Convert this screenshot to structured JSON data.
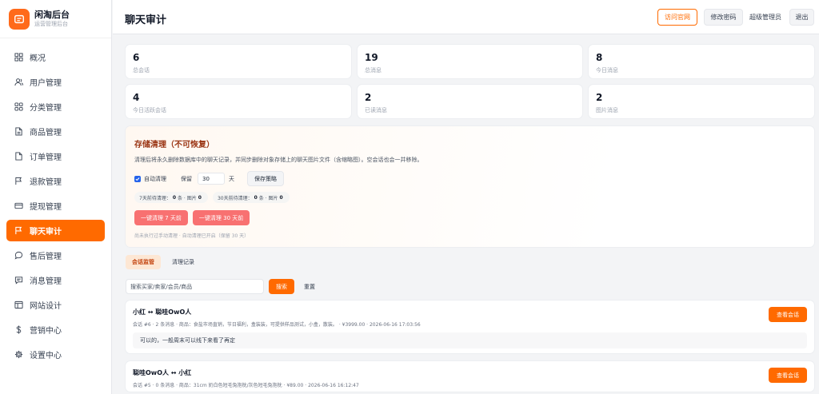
{
  "brand": {
    "title": "闲淘后台",
    "subtitle": "运营管理后台",
    "accent": "#ff6a00"
  },
  "sidebar": {
    "items": [
      {
        "label": "概况",
        "icon": "grid-icon"
      },
      {
        "label": "用户管理",
        "icon": "users-icon"
      },
      {
        "label": "分类管理",
        "icon": "category-icon"
      },
      {
        "label": "商品管理",
        "icon": "file-icon"
      },
      {
        "label": "订单管理",
        "icon": "document-icon"
      },
      {
        "label": "退款管理",
        "icon": "flag-icon"
      },
      {
        "label": "提现管理",
        "icon": "card-icon"
      },
      {
        "label": "聊天审计",
        "icon": "flag-icon",
        "active": true
      },
      {
        "label": "售后管理",
        "icon": "chat-icon"
      },
      {
        "label": "消息管理",
        "icon": "message-icon"
      },
      {
        "label": "网站设计",
        "icon": "layout-icon"
      },
      {
        "label": "营销中心",
        "icon": "dollar-icon"
      },
      {
        "label": "设置中心",
        "icon": "gear-icon"
      }
    ]
  },
  "header": {
    "title": "聊天审计",
    "visit_label": "访问官网",
    "password_label": "修改密码",
    "user_label": "超级管理员",
    "logout_label": "退出"
  },
  "stats": [
    {
      "value": "6",
      "label": "总会话"
    },
    {
      "value": "19",
      "label": "总消息"
    },
    {
      "value": "8",
      "label": "今日消息"
    },
    {
      "value": "4",
      "label": "今日活跃会话"
    },
    {
      "value": "2",
      "label": "已读消息"
    },
    {
      "value": "2",
      "label": "图片消息"
    }
  ],
  "storage": {
    "title": "存储清理（不可恢复）",
    "description": "清理后将永久删除数据库中的聊天记录，并同步删除对象存储上的聊天图片文件（含缩略图）。空会话也会一并移除。",
    "auto_clean_label": "自动清理",
    "auto_clean_checked": true,
    "keep_label": "保留",
    "keep_days": "30",
    "days_unit": "天",
    "save_label": "保存策略",
    "stat7": {
      "label": "7天前待清理：",
      "count": "0",
      "unit_msg": "条 · 图片",
      "images": "0"
    },
    "stat30": {
      "label": "30天前待清理：",
      "count": "0",
      "unit_msg": "条 · 图片",
      "images": "0"
    },
    "clean7_label": "一键清理 7 天前",
    "clean30_label": "一键清理 30 天前",
    "note": "尚未执行过手动清理 · 自动清理已开启（保留 30 天）"
  },
  "tabs": [
    {
      "label": "会话监管",
      "active": true
    },
    {
      "label": "清理记录",
      "active": false
    }
  ],
  "search": {
    "placeholder": "搜索买家/卖家/会员/商品",
    "search_label": "搜索",
    "reset_label": "重置"
  },
  "conversations": [
    {
      "title": "小红 ↔ 聪哇OwO人",
      "meta": "会话 #6 · 2 条消息 · 商品：食盐市场直销，节日福利，盒装装，可提供样品测试，小盒，散装。 · ¥3999.00 · 2026-06-16 17:03:56",
      "last_message": "可以的，一般周末可以线下来看了再定",
      "view_label": "查看会话"
    },
    {
      "title": "聪哇OwO人 ↔ 小红",
      "meta": "会话 #5 · 0 条消息 · 商品：31cm 奶白色短毛兔抱枕/灰色短毛兔抱枕 · ¥89.00 · 2026-06-16 16:12:47",
      "view_label": "查看会话"
    }
  ]
}
